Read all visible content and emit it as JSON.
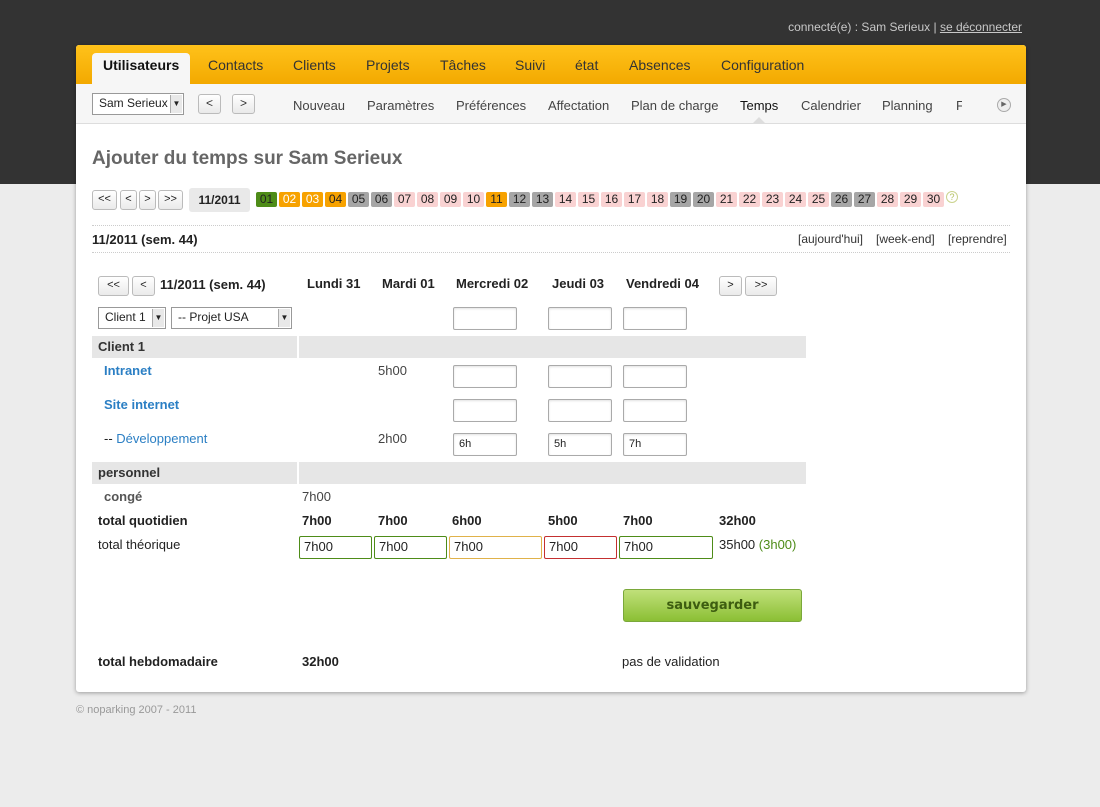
{
  "session": {
    "text": "connecté(e) : Sam Serieux |",
    "logout": "se déconnecter"
  },
  "tabs": [
    "Utilisateurs",
    "Contacts",
    "Clients",
    "Projets",
    "Tâches",
    "Suivi",
    "état",
    "Absences",
    "Configuration"
  ],
  "active_tab": "Utilisateurs",
  "user_select": "Sam Serieux",
  "prev_label": "<",
  "next_label": ">",
  "subnav": [
    "Nouveau",
    "Paramètres",
    "Préférences",
    "Affectation",
    "Plan de charge",
    "Temps",
    "Calendrier",
    "Planning",
    "F"
  ],
  "active_subnav": "Temps",
  "page_title": "Ajouter du temps sur Sam Serieux",
  "month_nav": {
    "first": "<<",
    "prev": "<",
    "next": ">",
    "last": ">>",
    "current": "11/2011"
  },
  "days": [
    {
      "n": "01",
      "s": "green"
    },
    {
      "n": "02",
      "s": "orange"
    },
    {
      "n": "03",
      "s": "orange"
    },
    {
      "n": "04",
      "s": "dorange"
    },
    {
      "n": "05",
      "s": "grey"
    },
    {
      "n": "06",
      "s": "grey"
    },
    {
      "n": "07",
      "s": "pink"
    },
    {
      "n": "08",
      "s": "pink"
    },
    {
      "n": "09",
      "s": "pink"
    },
    {
      "n": "10",
      "s": "pink"
    },
    {
      "n": "11",
      "s": "dorange"
    },
    {
      "n": "12",
      "s": "grey"
    },
    {
      "n": "13",
      "s": "grey"
    },
    {
      "n": "14",
      "s": "pink"
    },
    {
      "n": "15",
      "s": "pink"
    },
    {
      "n": "16",
      "s": "pink"
    },
    {
      "n": "17",
      "s": "pink"
    },
    {
      "n": "18",
      "s": "pink"
    },
    {
      "n": "19",
      "s": "grey"
    },
    {
      "n": "20",
      "s": "grey"
    },
    {
      "n": "21",
      "s": "pink"
    },
    {
      "n": "22",
      "s": "pink"
    },
    {
      "n": "23",
      "s": "pink"
    },
    {
      "n": "24",
      "s": "pink"
    },
    {
      "n": "25",
      "s": "pink"
    },
    {
      "n": "26",
      "s": "grey"
    },
    {
      "n": "27",
      "s": "grey"
    },
    {
      "n": "28",
      "s": "pink"
    },
    {
      "n": "29",
      "s": "pink"
    },
    {
      "n": "30",
      "s": "pink"
    }
  ],
  "help": "?",
  "week_label": "11/2011 (sem. 44)",
  "week_links": [
    "[aujourd'hui]",
    "[week-end]",
    "[reprendre]"
  ],
  "grid": {
    "nav_first": "<<",
    "nav_prev": "<",
    "nav_next": ">",
    "nav_last": ">>",
    "week": "11/2011 (sem. 44)",
    "headers": [
      "Lundi 31",
      "Mardi 01",
      "Mercredi 02",
      "Jeudi 03",
      "Vendredi 04"
    ],
    "client_select": "Client 1",
    "project_select": "-- Projet USA",
    "group1": "Client 1",
    "row_intranet": {
      "label": "Intranet",
      "mardi": "5h00"
    },
    "row_site": {
      "label": "Site internet"
    },
    "row_dev": {
      "prefix": "-- ",
      "label": "Développement",
      "mardi": "2h00",
      "mercredi": "6h",
      "jeudi": "5h",
      "vendredi": "7h"
    },
    "group2": "personnel",
    "row_conge": {
      "label": "congé",
      "lundi": "7h00"
    },
    "total_quot": {
      "label": "total quotidien",
      "values": [
        "7h00",
        "7h00",
        "6h00",
        "5h00",
        "7h00"
      ],
      "sum": "32h00"
    },
    "total_theo": {
      "label": "total théorique",
      "values": [
        "7h00",
        "7h00",
        "7h00",
        "7h00",
        "7h00"
      ],
      "sum": "35h00",
      "diff": "(3h00)"
    },
    "save": "sauvegarder",
    "total_hebdo": {
      "label": "total hebdomadaire",
      "value": "32h00",
      "status": "pas de validation"
    }
  },
  "footer": "© noparking 2007 - 2011"
}
